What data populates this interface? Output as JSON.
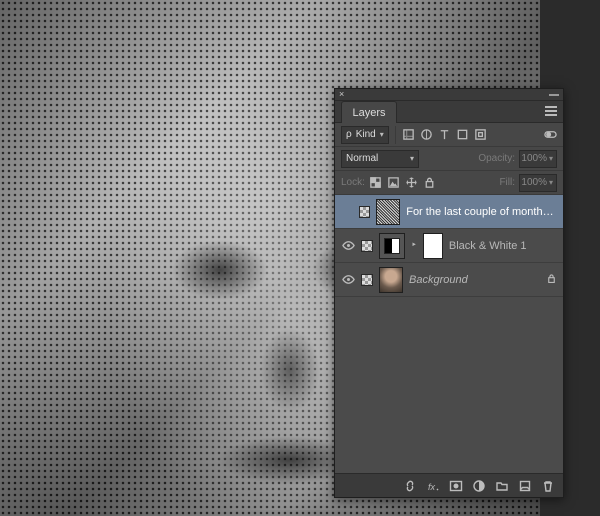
{
  "panel": {
    "title": "Layers",
    "filter": {
      "kind_label": "Kind",
      "kind_prefix": "ρ"
    },
    "blend": {
      "mode": "Normal",
      "opacity_label": "Opacity:",
      "opacity_value": "100%",
      "lock_label": "Lock:",
      "fill_label": "Fill:",
      "fill_value": "100%"
    },
    "layers": [
      {
        "name": "For the last couple of months, Se...",
        "visible": false,
        "selected": true,
        "type": "text",
        "locked": false
      },
      {
        "name": "Black & White 1",
        "visible": true,
        "selected": false,
        "type": "adjustment",
        "locked": false
      },
      {
        "name": "Background",
        "visible": true,
        "selected": false,
        "type": "image",
        "locked": true
      }
    ],
    "link_glyph": "‣"
  }
}
